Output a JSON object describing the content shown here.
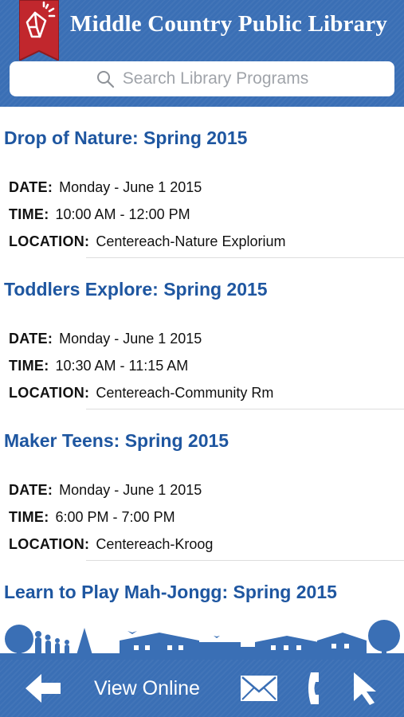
{
  "header": {
    "title": "Middle Country Public Library",
    "logo_icon": "library-logo-icon",
    "colors": {
      "bar": "#3a6fb5",
      "ribbon": "#c1272d"
    }
  },
  "search": {
    "placeholder": "Search Library Programs",
    "icon": "search-icon"
  },
  "labels": {
    "date": "DATE:",
    "time": "TIME:",
    "location": "LOCATION:"
  },
  "programs": [
    {
      "title": "Drop of Nature: Spring 2015",
      "date": "Monday - June 1 2015",
      "time": "10:00 AM - 12:00 PM",
      "location": "Centereach-Nature Explorium"
    },
    {
      "title": "Toddlers Explore: Spring 2015",
      "date": "Monday - June 1 2015",
      "time": "10:30 AM - 11:15 AM",
      "location": "Centereach-Community Rm"
    },
    {
      "title": "Maker Teens: Spring 2015",
      "date": "Monday - June 1 2015",
      "time": "6:00 PM - 7:00 PM",
      "location": "Centereach-Kroog"
    },
    {
      "title": "Learn to Play Mah-Jongg: Spring 2015"
    }
  ],
  "toolbar": {
    "back_icon": "back-arrow-icon",
    "view_online_label": "View Online",
    "mail_icon": "mail-icon",
    "phone_icon": "phone-icon",
    "pointer_icon": "pointer-icon"
  },
  "colors": {
    "accent_text": "#1e56a0",
    "body_text": "#111111",
    "placeholder_text": "#a0a4aa"
  }
}
